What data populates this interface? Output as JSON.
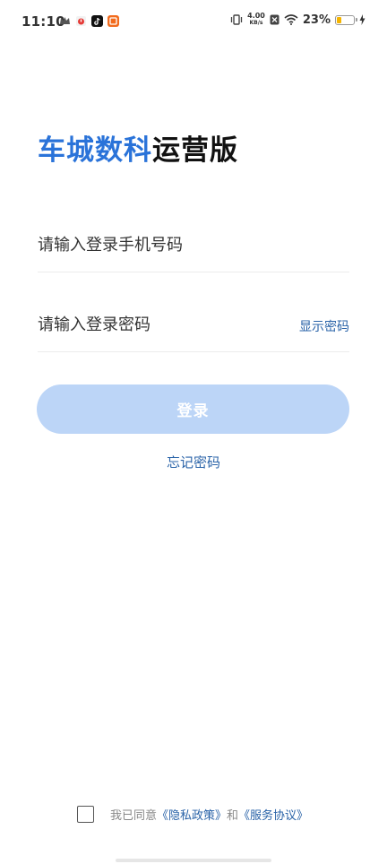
{
  "status_bar": {
    "time": "11:10",
    "net_speed_value": "4.00",
    "net_speed_unit": "KB/s",
    "battery_percent": "23%",
    "battery_level": 0.23,
    "icons": [
      "crown-icon",
      "alarm-app-icon",
      "tiktok-icon",
      "orange-app-icon",
      "vibrate-icon",
      "sim-off-icon",
      "wifi-icon",
      "battery-icon",
      "charging-icon"
    ]
  },
  "title": {
    "brand": "车城数科",
    "suffix": "运营版"
  },
  "form": {
    "phone_placeholder": "请输入登录手机号码",
    "password_placeholder": "请输入登录密码",
    "show_password_label": "显示密码",
    "login_label": "登录",
    "forgot_password_label": "忘记密码"
  },
  "agreement": {
    "prefix": "我已同意",
    "privacy_link": "《隐私政策》",
    "conjunction": "和",
    "service_link": "《服务协议》"
  },
  "colors": {
    "brand_blue": "#2a73d9",
    "link_blue": "#2a63a8",
    "button_disabled": "#bcd5f7"
  }
}
